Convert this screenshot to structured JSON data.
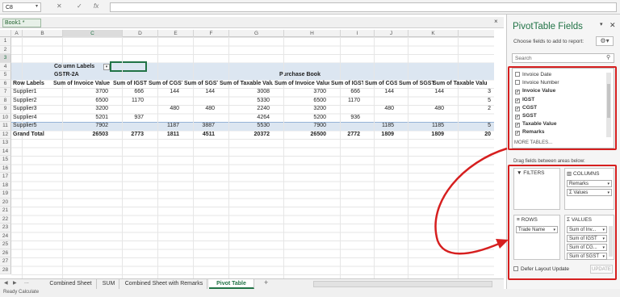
{
  "formula_bar": {
    "name_box": "C8",
    "fx": "fx",
    "cancel": "✕",
    "enter": "✓",
    "formula": ""
  },
  "workbook": {
    "tab_label": "Book1 *",
    "close": "×"
  },
  "columns": [
    "A",
    "B",
    "C",
    "D",
    "E",
    "F",
    "G",
    "H",
    "I",
    "J",
    "K"
  ],
  "rows": [
    "1",
    "2",
    "3",
    "4",
    "5",
    "6",
    "7",
    "8",
    "9",
    "10",
    "11",
    "12",
    "13",
    "14",
    "15",
    "16",
    "17",
    "18",
    "19",
    "20",
    "21",
    "22",
    "23",
    "24",
    "25",
    "26",
    "27",
    "28"
  ],
  "pivot": {
    "column_labels": "Column Labels",
    "group1": "GSTR-2A",
    "group2": "Purchase Book",
    "row_labels": "Row Labels",
    "headers": [
      "Sum of Invoice Value",
      "Sum of IGST",
      "Sum of CGST",
      "Sum of SGST",
      "Sum of Taxable Value",
      "Sum of Invoice Value",
      "Sum of IGST",
      "Sum of CGST",
      "Sum of SGST",
      "Sum of Taxable Valu"
    ],
    "rows": [
      {
        "label": "Supplier1",
        "values": [
          "3700",
          "666",
          "144",
          "144",
          "3008",
          "3700",
          "666",
          "144",
          "144",
          "3"
        ]
      },
      {
        "label": "Supplier2",
        "values": [
          "6500",
          "1170",
          "",
          "",
          "5330",
          "6500",
          "1170",
          "",
          "",
          "5"
        ]
      },
      {
        "label": "Supplier3",
        "values": [
          "3200",
          "",
          "480",
          "480",
          "2240",
          "3200",
          "",
          "480",
          "480",
          "2"
        ]
      },
      {
        "label": "Supplier4",
        "values": [
          "5201",
          "937",
          "",
          "",
          "4264",
          "5200",
          "936",
          "",
          "",
          ""
        ]
      },
      {
        "label": "Supplier5",
        "values": [
          "7902",
          "",
          "1187",
          "3887",
          "5530",
          "7900",
          "",
          "1185",
          "1185",
          "5"
        ]
      }
    ],
    "grand_total": {
      "label": "Grand Total",
      "values": [
        "26503",
        "2773",
        "1811",
        "4511",
        "20372",
        "26500",
        "2772",
        "1809",
        "1809",
        "20"
      ]
    }
  },
  "sheet_tabs": {
    "nav": [
      "◀",
      "▶",
      "..."
    ],
    "tabs": [
      "Combined Sheet",
      "SUM",
      "Combined Sheet with Remarks",
      "Pivot Table"
    ],
    "active_index": 3,
    "add": "+"
  },
  "status": {
    "text": "Ready   Calculate"
  },
  "pivot_pane": {
    "title": "PivotTable Fields",
    "subtitle": "Choose fields to add to report:",
    "search_placeholder": "Search",
    "fields": [
      {
        "label": "Invoice Date",
        "checked": false
      },
      {
        "label": "Invoice Number",
        "checked": false
      },
      {
        "label": "Invoice Value",
        "checked": true
      },
      {
        "label": "IGST",
        "checked": true
      },
      {
        "label": "CGST",
        "checked": true
      },
      {
        "label": "SGST",
        "checked": true
      },
      {
        "label": "Taxable Value",
        "checked": true
      },
      {
        "label": "Remarks",
        "checked": true
      }
    ],
    "more_tables": "MORE TABLES...",
    "drag_label": "Drag fields between areas below:",
    "filters_title": "FILTERS",
    "columns_title": "COLUMNS",
    "rows_title": "ROWS",
    "values_title": "VALUES",
    "columns_items": [
      "Remarks",
      "Σ Values"
    ],
    "rows_items": [
      "Trade Name"
    ],
    "values_items": [
      "Sum of Inv...",
      "Sum of IGST",
      "Sum of CG...",
      "Sum of SGST"
    ],
    "defer_label": "Defer Layout Update",
    "update_label": "UPDATE"
  },
  "colors": {
    "accent": "#217346",
    "annotation": "#d61f1f",
    "pivot_band": "#dce6f1"
  }
}
